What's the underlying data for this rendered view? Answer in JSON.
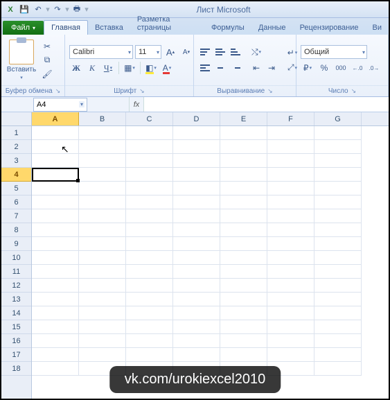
{
  "title": "Лист Microsoft",
  "qat": {
    "excel": "X",
    "save": "💾",
    "undo": "↶",
    "redo": "↷",
    "print": "🖶"
  },
  "tabs": {
    "file": "Файл",
    "items": [
      "Главная",
      "Вставка",
      "Разметка страницы",
      "Формулы",
      "Данные",
      "Рецензирование",
      "Ви"
    ],
    "active_index": 0
  },
  "ribbon": {
    "clipboard": {
      "paste": "Вставить",
      "label": "Буфер обмена"
    },
    "font": {
      "name": "Calibri",
      "size": "11",
      "grow": "A",
      "shrink": "A",
      "bold": "Ж",
      "italic": "К",
      "underline": "Ч",
      "label": "Шрифт"
    },
    "alignment": {
      "wrap_icon": "↵",
      "merge_icon": "⤢",
      "label": "Выравнивание"
    },
    "number": {
      "format": "Общий",
      "currency": "₽",
      "percent": "%",
      "comma": "000",
      "inc": "←.0",
      "dec": ".0→",
      "label": "Число"
    }
  },
  "namebox": "A4",
  "fx_label": "fx",
  "grid": {
    "cols": [
      "A",
      "B",
      "C",
      "D",
      "E",
      "F",
      "G"
    ],
    "rows": [
      "1",
      "2",
      "3",
      "4",
      "5",
      "6",
      "7",
      "8",
      "9",
      "10",
      "11",
      "12",
      "13",
      "14",
      "15",
      "16",
      "17",
      "18"
    ],
    "active_col": 0,
    "active_row": 3
  },
  "cursor_glyph": "↖",
  "watermark": "vk.com/urokiexcel2010"
}
